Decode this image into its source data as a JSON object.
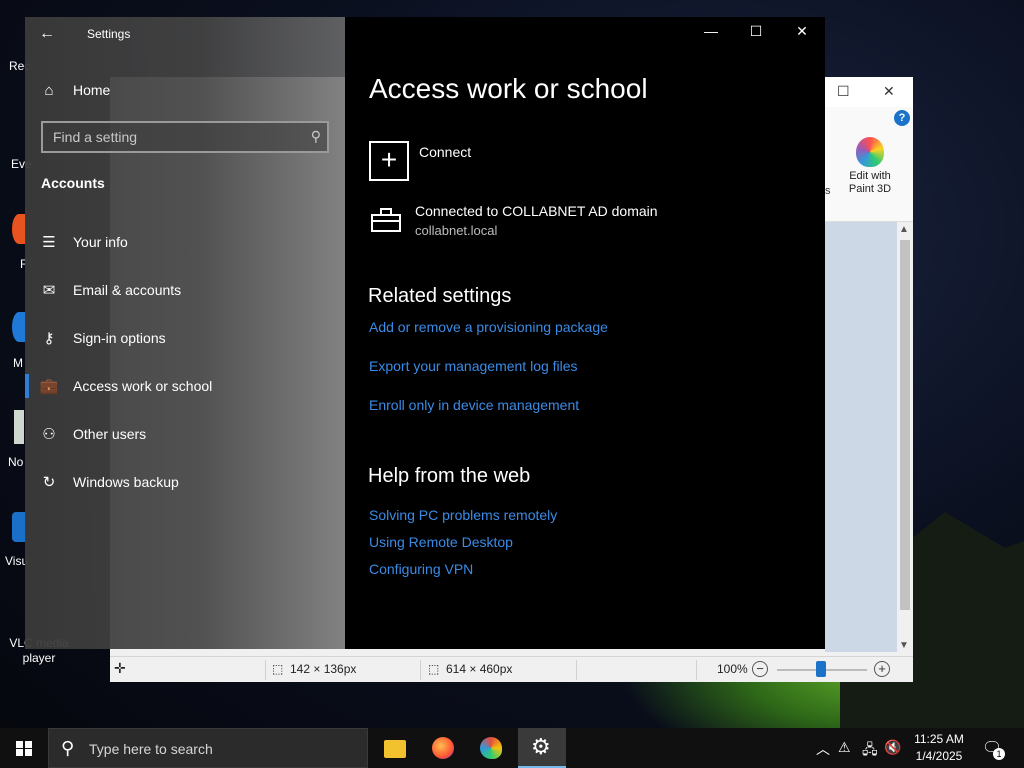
{
  "desktop": {
    "icons": [
      {
        "label": "Rec"
      },
      {
        "label": "Eve"
      },
      {
        "label": "F"
      },
      {
        "label": "M"
      },
      {
        "label": "No"
      },
      {
        "label": "Visu"
      },
      {
        "label": "VLC media player"
      }
    ]
  },
  "paint": {
    "edit_paint3d": "Edit with Paint 3D",
    "help": "?",
    "partial_s": "s",
    "status": {
      "selection_size": "142 × 136px",
      "image_size": "614 × 460px",
      "zoom": "100%"
    }
  },
  "settings": {
    "window_title": "Settings",
    "back_glyph": "←",
    "nav": {
      "home": "Home",
      "search_placeholder": "Find a setting",
      "section": "Accounts",
      "items": [
        {
          "label": "Your info",
          "icon": "person-card-icon"
        },
        {
          "label": "Email & accounts",
          "icon": "mail-icon"
        },
        {
          "label": "Sign-in options",
          "icon": "key-icon"
        },
        {
          "label": "Access work or school",
          "icon": "briefcase-icon"
        },
        {
          "label": "Other users",
          "icon": "person-icon"
        },
        {
          "label": "Windows backup",
          "icon": "sync-icon"
        }
      ]
    },
    "content": {
      "title": "Access work or school",
      "connect_label": "Connect",
      "account_name": "Connected to COLLABNET AD domain",
      "account_domain": "collabnet.local",
      "related_heading": "Related settings",
      "related_links": [
        "Add or remove a provisioning package",
        "Export your management log files",
        "Enroll only in device management"
      ],
      "help_heading": "Help from the web",
      "help_links": [
        "Solving PC problems remotely",
        "Using Remote Desktop",
        "Configuring VPN"
      ]
    }
  },
  "taskbar": {
    "search_placeholder": "Type here to search",
    "time": "11:25 AM",
    "date": "1/4/2025",
    "notification_count": "1"
  },
  "colors": {
    "accent": "#2f7fd8",
    "link": "#3a8be6",
    "content_bg": "#000000"
  }
}
